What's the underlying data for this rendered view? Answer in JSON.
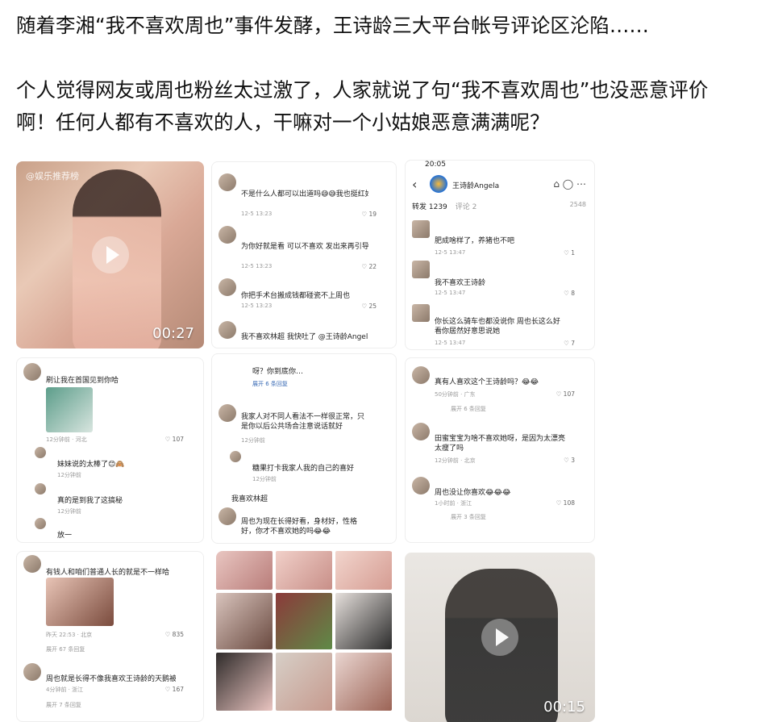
{
  "post": {
    "line1": "随着李湘“我不喜欢周也”事件发酵，王诗龄三大平台帐号评论区沦陷……",
    "line2": "个人觉得网友或周也粉丝太过激了，人家就说了句“我不喜欢周也”也没恶意评价",
    "line3": "啊！任何人都有不喜欢的人，干嘛对一个小姑娘恶意满满呢？"
  },
  "video1": {
    "watermark": "@娱乐推荐榜",
    "duration": "00:27"
  },
  "video2": {
    "duration": "00:15"
  },
  "shot_mid_top": {
    "comments": [
      {
        "text": "不是什么人都可以出道吗😅😅我也挺红好的吧",
        "meta": "12-5 13:23",
        "likes": "19"
      },
      {
        "text": "为你好就是看 可以不喜欢 发出来再引导什么好😐😐",
        "meta": "12-5 13:23",
        "likes": "22"
      },
      {
        "text": "你把手术台搬成钱都碰瓷不上周也",
        "meta": "12-5 13:23",
        "likes": "25"
      },
      {
        "text": "我不喜欢林超 我快吐了 @王诗龄Angela 😂",
        "meta": "12-5 13:23",
        "likes": ""
      }
    ]
  },
  "shot_right_top": {
    "time": "20:05",
    "account": "王诗龄Angela",
    "tab_repost": "转发 1239",
    "tab_comment": "评论 2",
    "count": "2548",
    "comments": [
      {
        "text": "肥成啥样了，养猪也不吧",
        "meta": "12-5 13:47",
        "likes": "1"
      },
      {
        "text": "我不喜欢王诗龄",
        "meta": "12-5 13:47",
        "likes": "8"
      },
      {
        "text": "你长这么骑车也都没说你 周也长这么好看你居然好意思说她",
        "meta": "12-5 13:47",
        "likes": "7"
      }
    ]
  },
  "shot_left_mid": {
    "comments": [
      {
        "text": "刷让我在首国见到你哈",
        "meta": "12分钟前 · 河北",
        "likes": "107"
      },
      {
        "text": "妹妹说的太棒了😊🙈",
        "meta": "12分钟前",
        "likes": ""
      },
      {
        "text": "真的是到我了这搞秘",
        "meta": "12分钟前",
        "likes": ""
      },
      {
        "text": "放一",
        "meta": "",
        "likes": ""
      }
    ]
  },
  "shot_mid_mid": {
    "comments": [
      {
        "text": "呀？你到底你…",
        "meta": "展开 6 条回复",
        "likes": ""
      },
      {
        "text": "我家人对不同人看法不一样很正常，只是你以后公共场合注意说话就好",
        "meta": "12分钟前",
        "likes": ""
      },
      {
        "text": "糖果打卡我家人我的自己的喜好",
        "meta": "12分钟前",
        "likes": ""
      },
      {
        "text": "我喜欢林超",
        "meta": "",
        "likes": ""
      },
      {
        "text": "周也为现在长得好看，身材好，性格好，你才不喜欢她的吗😂😂",
        "meta": "12分钟前",
        "likes": ""
      }
    ]
  },
  "shot_right_mid": {
    "comments": [
      {
        "text": "真有人喜欢这个王诗龄吗？😂😂",
        "meta": "50分钟前 · 广东",
        "likes": "107"
      },
      {
        "text": "展开 6 条回复",
        "meta": "",
        "likes": ""
      },
      {
        "text": "田蜜宝宝为啥不喜欢她呀，是因为太漂亮太瘦了吗",
        "meta": "12分钟前 · 北京",
        "likes": "3"
      },
      {
        "text": "周也没让你喜欢😂😂😂",
        "meta": "1小时前 · 浙江",
        "likes": "108"
      },
      {
        "text": "展开 3 条回复",
        "meta": "",
        "likes": ""
      }
    ]
  },
  "shot_left_bottom": {
    "comments": [
      {
        "text": "有钱人和咱们普通人长的就是不一样哈",
        "meta": "昨天 22:53 · 北京",
        "likes": "835"
      },
      {
        "text": "展开 67 条回复",
        "meta": "",
        "likes": ""
      },
      {
        "text": "周也就是长得不像我喜欢王诗龄的天鹅被跑了😅",
        "meta": "4分钟前 · 浙江",
        "likes": "167"
      },
      {
        "text": "展开 7 条回复",
        "meta": "",
        "likes": ""
      }
    ]
  },
  "colors": {
    "text": "#111111",
    "muted": "#999999",
    "background": "#ffffff"
  }
}
